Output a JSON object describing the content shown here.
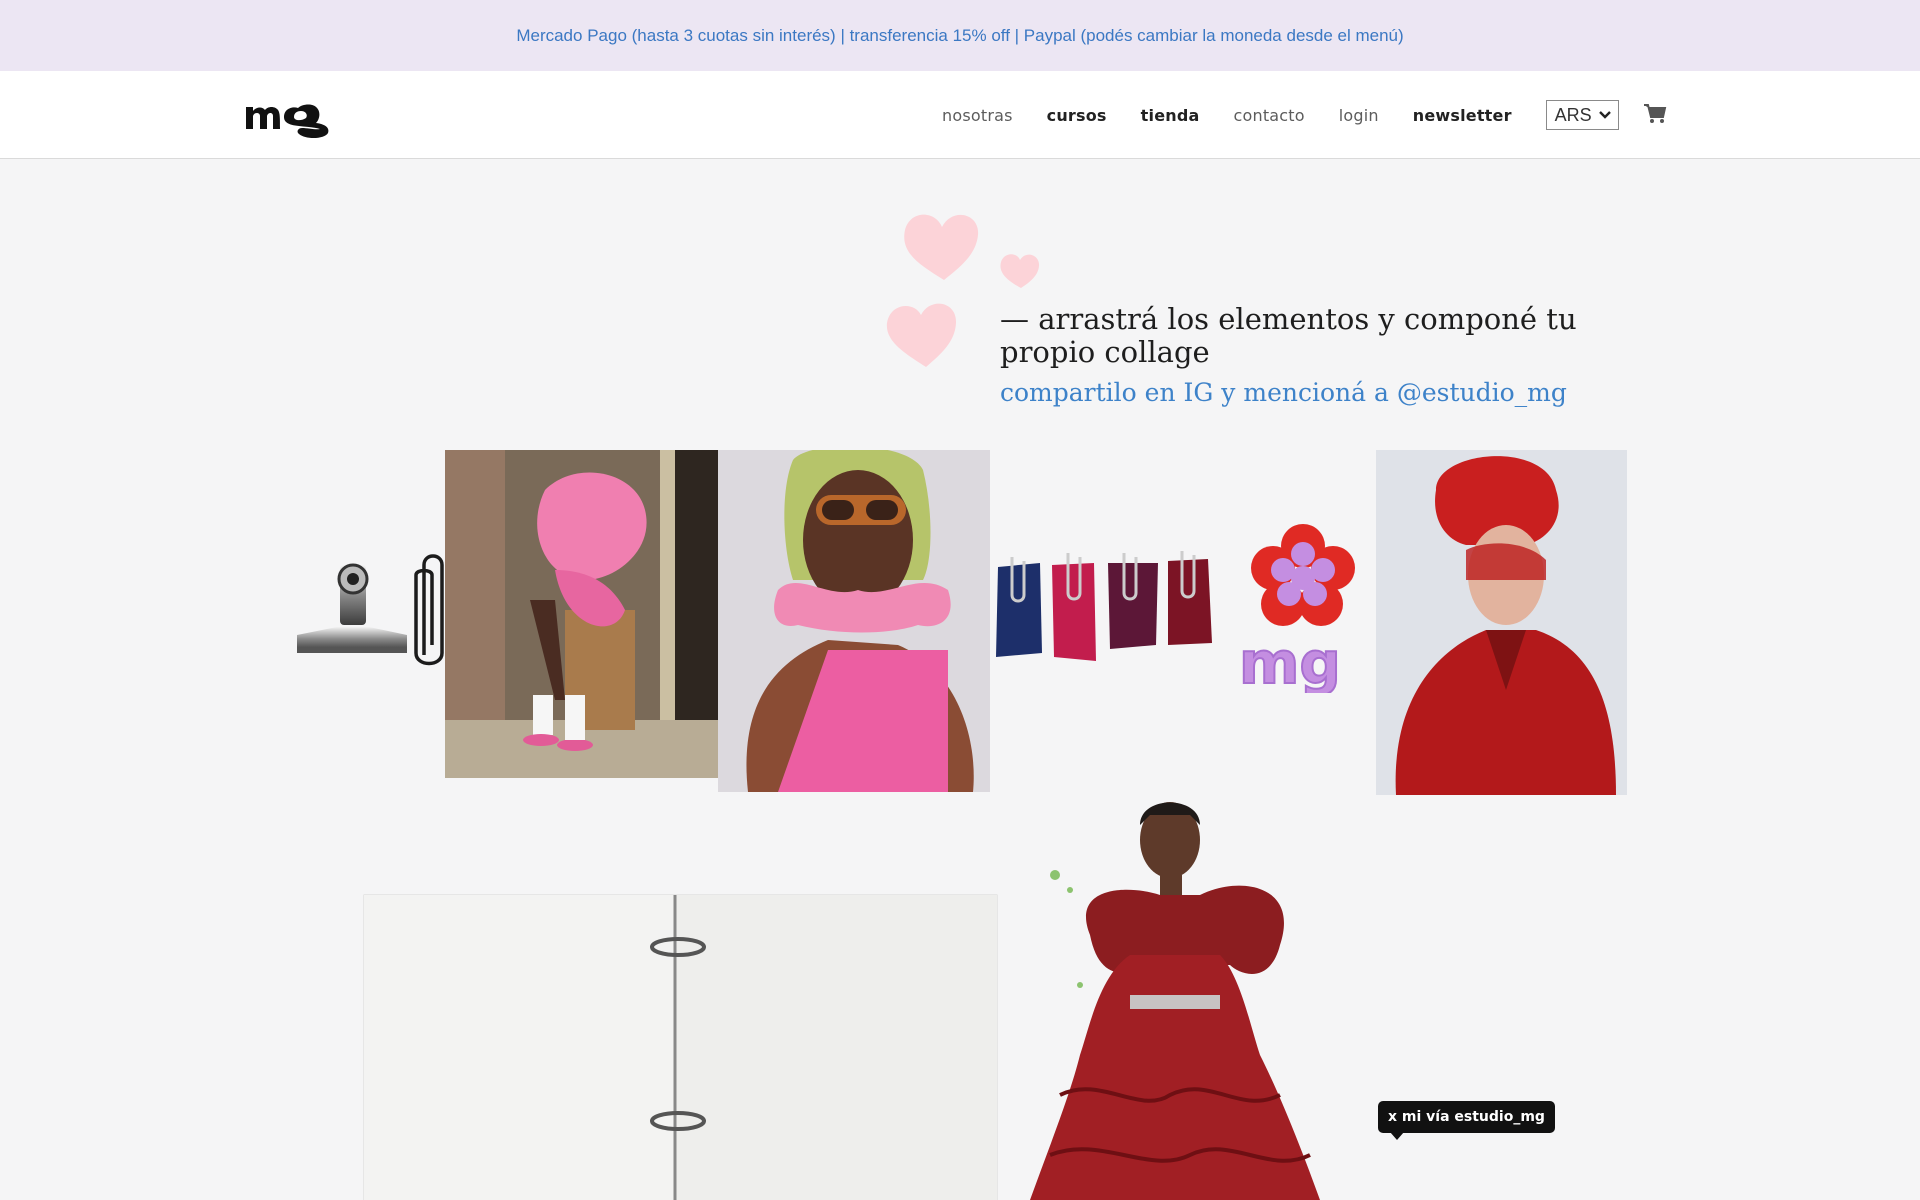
{
  "promo": {
    "text": "Mercado Pago (hasta 3 cuotas sin interés) | transferencia 15% off | Paypal (podés cambiar la moneda desde el menú)"
  },
  "header": {
    "logo_alt": "mg",
    "nav": [
      {
        "label": "nosotras",
        "bold": false
      },
      {
        "label": "cursos",
        "bold": true
      },
      {
        "label": "tienda",
        "bold": true
      },
      {
        "label": "contacto",
        "bold": false
      },
      {
        "label": "login",
        "bold": false
      },
      {
        "label": "newsletter",
        "bold": true
      }
    ],
    "currency": {
      "selected": "ARS"
    },
    "cart_icon": "cart-icon"
  },
  "collage": {
    "headline": "— arrastrá los elementos y componé tu propio collage",
    "subline": "compartilo en IG y mencioná a @estudio_mg",
    "tooltip": "x mi vía estudio_mg"
  },
  "colors": {
    "promo_bg": "#ece6f3",
    "promo_text": "#3b78c3",
    "accent_blue": "#3d82c9",
    "heart_pink": "#fcd3d8",
    "page_bg": "#f5f5f6"
  }
}
